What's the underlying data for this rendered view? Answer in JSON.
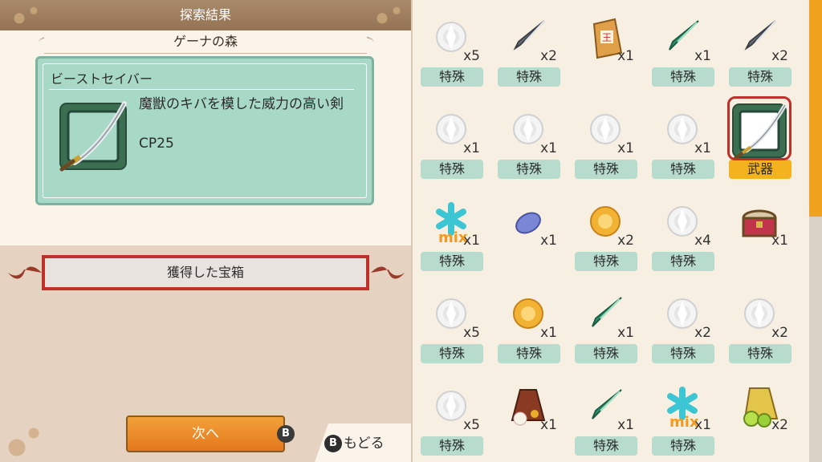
{
  "header": {
    "title": "探索結果"
  },
  "location": {
    "name": "ゲーナの森"
  },
  "detail": {
    "name": "ビーストセイバー",
    "description": "魔獣のキバを模した威力の高い剣",
    "cp": "CP25",
    "icon": "saber-icon"
  },
  "chest_section": {
    "label": "獲得した宝箱"
  },
  "buttons": {
    "next": "次へ",
    "next_key": "B",
    "back_key": "B",
    "back": "もどる"
  },
  "items": [
    {
      "icon": "white-crystal-icon",
      "qty": "x5",
      "tag": "特殊"
    },
    {
      "icon": "blade-shard-icon",
      "qty": "x2",
      "tag": "特殊"
    },
    {
      "icon": "sack-icon",
      "qty": "x1",
      "tag": ""
    },
    {
      "icon": "green-shard-icon",
      "qty": "x1",
      "tag": "特殊"
    },
    {
      "icon": "blade-shard-icon",
      "qty": "x2",
      "tag": "特殊"
    },
    {
      "icon": "white-crystal-icon",
      "qty": "x1",
      "tag": "特殊"
    },
    {
      "icon": "white-crystal-icon",
      "qty": "x1",
      "tag": "特殊"
    },
    {
      "icon": "white-crystal-icon",
      "qty": "x1",
      "tag": "特殊"
    },
    {
      "icon": "white-crystal-icon",
      "qty": "x1",
      "tag": "特殊"
    },
    {
      "icon": "saber-icon",
      "qty": "",
      "tag": "武器",
      "selected": true
    },
    {
      "icon": "mix-snowflake-icon",
      "qty": "x1",
      "tag": "特殊",
      "mix": "mix"
    },
    {
      "icon": "blue-stone-icon",
      "qty": "x1",
      "tag": ""
    },
    {
      "icon": "amber-crystal-icon",
      "qty": "x2",
      "tag": "特殊"
    },
    {
      "icon": "white-crystal-icon",
      "qty": "x4",
      "tag": "特殊"
    },
    {
      "icon": "treasure-chest-icon",
      "qty": "x1",
      "tag": ""
    },
    {
      "icon": "white-crystal-icon",
      "qty": "x5",
      "tag": "特殊"
    },
    {
      "icon": "amber-crystal-icon",
      "qty": "x1",
      "tag": "特殊"
    },
    {
      "icon": "green-shard-icon",
      "qty": "x1",
      "tag": "特殊"
    },
    {
      "icon": "white-crystal-icon",
      "qty": "x2",
      "tag": "特殊"
    },
    {
      "icon": "white-crystal-icon",
      "qty": "x2",
      "tag": "特殊"
    },
    {
      "icon": "white-crystal-icon",
      "qty": "x5",
      "tag": "特殊"
    },
    {
      "icon": "flower-bag-icon",
      "qty": "x1",
      "tag": ""
    },
    {
      "icon": "green-shard-icon",
      "qty": "x1",
      "tag": "特殊"
    },
    {
      "icon": "mix-snowflake-icon",
      "qty": "x1",
      "tag": "特殊",
      "mix": "mix"
    },
    {
      "icon": "fruit-bag-icon",
      "qty": "x2",
      "tag": ""
    }
  ],
  "colors": {
    "tag_special": "#b7dccd",
    "tag_weapon": "#f4b21e",
    "select_frame": "#c0302a",
    "scroll": "#f0a21c"
  }
}
